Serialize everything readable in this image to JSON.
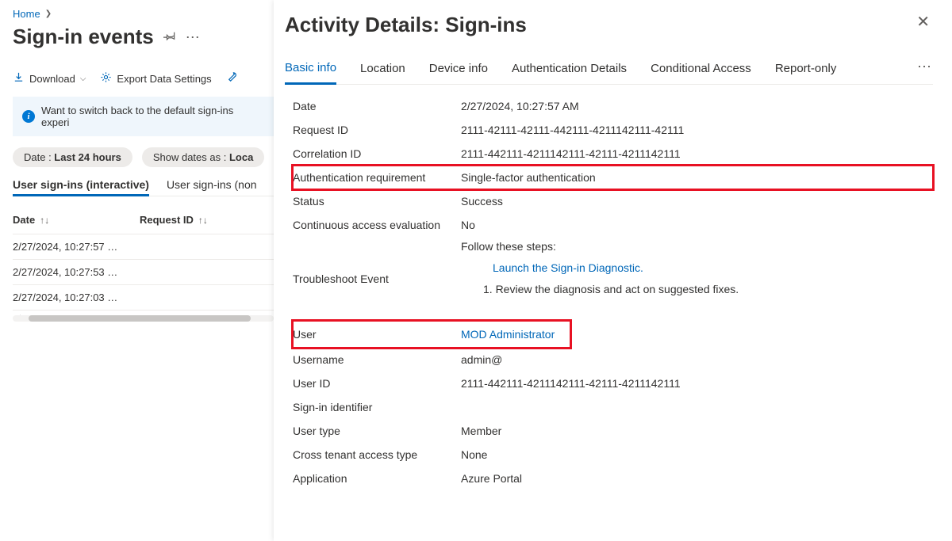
{
  "breadcrumb": {
    "home": "Home"
  },
  "page": {
    "title": "Sign-in events"
  },
  "toolbar": {
    "download": "Download",
    "export": "Export Data Settings"
  },
  "infobar": {
    "text": "Want to switch back to the default sign-ins experi"
  },
  "filters": {
    "date_prefix": "Date : ",
    "date_value": "Last 24 hours",
    "showdates_prefix": "Show dates as : ",
    "showdates_value": "Loca"
  },
  "subtabs": {
    "interactive": "User sign-ins (interactive)",
    "noninteractive": "User sign-ins (non"
  },
  "table": {
    "headers": {
      "date": "Date",
      "request_id": "Request ID"
    },
    "rows": [
      {
        "date": "2/27/2024, 10:27:57 …"
      },
      {
        "date": "2/27/2024, 10:27:53 …"
      },
      {
        "date": "2/27/2024, 10:27:03 …"
      }
    ]
  },
  "panel": {
    "title": "Activity Details: Sign-ins",
    "tabs": {
      "basic": "Basic info",
      "location": "Location",
      "device": "Device info",
      "auth": "Authentication Details",
      "ca": "Conditional Access",
      "report": "Report-only"
    },
    "fields": {
      "date_label": "Date",
      "date_value": "2/27/2024, 10:27:57 AM",
      "request_label": "Request ID",
      "request_value": "2111-42111-42111-442111-4211142111-42111",
      "correlation_label": "Correlation ID",
      "correlation_value": "2111-442111-4211142111-42111-4211142111",
      "authreq_label": "Authentication requirement",
      "authreq_value": "Single-factor authentication",
      "status_label": "Status",
      "status_value": "Success",
      "cae_label": "Continuous access evaluation",
      "cae_value": "No",
      "ts_label": "Troubleshoot Event",
      "ts_follow": "Follow these steps:",
      "ts_link": "Launch the Sign-in Diagnostic.",
      "ts_review": "1. Review the diagnosis and act on suggested fixes.",
      "user_label": "User",
      "user_value": "MOD Administrator",
      "username_label": "Username",
      "username_value": "admin@",
      "userid_label": "User ID",
      "userid_value": "2111-442111-4211142111-42111-4211142111",
      "signinid_label": "Sign-in identifier",
      "signinid_value": "",
      "usertype_label": "User type",
      "usertype_value": "Member",
      "crosstenant_label": "Cross tenant access type",
      "crosstenant_value": "None",
      "app_label": "Application",
      "app_value": "Azure Portal"
    }
  }
}
